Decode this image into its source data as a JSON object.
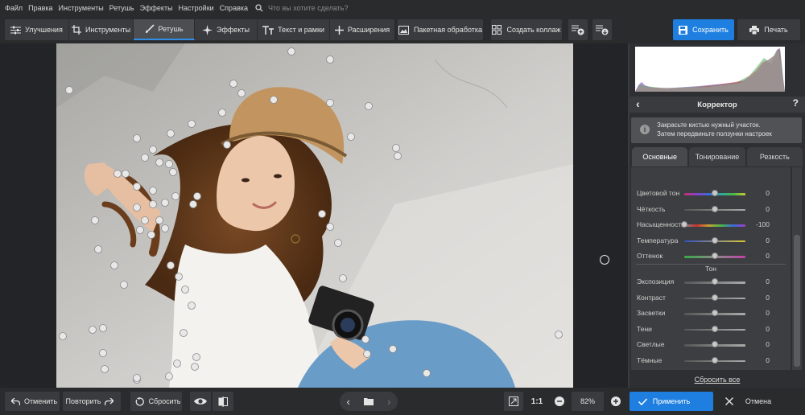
{
  "menu": [
    "Файл",
    "Правка",
    "Инструменты",
    "Ретушь",
    "Эффекты",
    "Настройки",
    "Справка"
  ],
  "search": {
    "placeholder": "Что вы хотите сделать?"
  },
  "tabs": [
    {
      "label": "Улучшения",
      "icon": "sliders-icon"
    },
    {
      "label": "Инструменты",
      "icon": "crop-icon"
    },
    {
      "label": "Ретушь",
      "icon": "brush-icon",
      "active": true
    },
    {
      "label": "Эффекты",
      "icon": "sparkle-icon"
    },
    {
      "label": "Текст и рамки",
      "icon": "text-icon"
    },
    {
      "label": "Расширения",
      "icon": "plus-icon"
    }
  ],
  "toolbar": {
    "batch_label": "Пакетная обработка",
    "collage_label": "Создать коллаж",
    "save_label": "Сохранить",
    "print_label": "Печать"
  },
  "panel": {
    "title": "Корректор",
    "info_line1": "Закрасьте кистью нужный участок.",
    "info_line2": "Затем передвиньте ползунки настроек",
    "tabs": [
      "Основные",
      "Тонирование",
      "Резкость"
    ],
    "tone_section": "Тон",
    "reset_all": "Сбросить все",
    "sliders_color": [
      {
        "label": "Цветовой тон",
        "value": "0",
        "level": 0.5,
        "track": "hue"
      },
      {
        "label": "Чёткость",
        "value": "0",
        "level": 0.5,
        "track": "gray"
      },
      {
        "label": "Насыщенность",
        "value": "-100",
        "level": 0.0,
        "track": "sat"
      },
      {
        "label": "Температура",
        "value": "0",
        "level": 0.5,
        "track": "temp"
      },
      {
        "label": "Оттенок",
        "value": "0",
        "level": 0.5,
        "track": "tint"
      }
    ],
    "sliders_tone": [
      {
        "label": "Экспозиция",
        "value": "0",
        "level": 0.5,
        "track": "gray"
      },
      {
        "label": "Контраст",
        "value": "0",
        "level": 0.5,
        "track": "gray"
      },
      {
        "label": "Засветки",
        "value": "0",
        "level": 0.5,
        "track": "gray"
      },
      {
        "label": "Тени",
        "value": "0",
        "level": 0.5,
        "track": "gray"
      },
      {
        "label": "Светлые",
        "value": "0",
        "level": 0.5,
        "track": "gray"
      },
      {
        "label": "Тёмные",
        "value": "0",
        "level": 0.5,
        "track": "gray"
      }
    ]
  },
  "bottom": {
    "undo_label": "Отменить",
    "redo_label": "Повторить",
    "reset_label": "Сбросить",
    "ratio_label": "1:1",
    "zoom_value": "82%",
    "apply_label": "Применить",
    "cancel_label": "Отмена"
  },
  "colors": {
    "accent": "#1f7fe0",
    "panel": "#2e2f32",
    "toolbar": "#2a2b2d"
  }
}
